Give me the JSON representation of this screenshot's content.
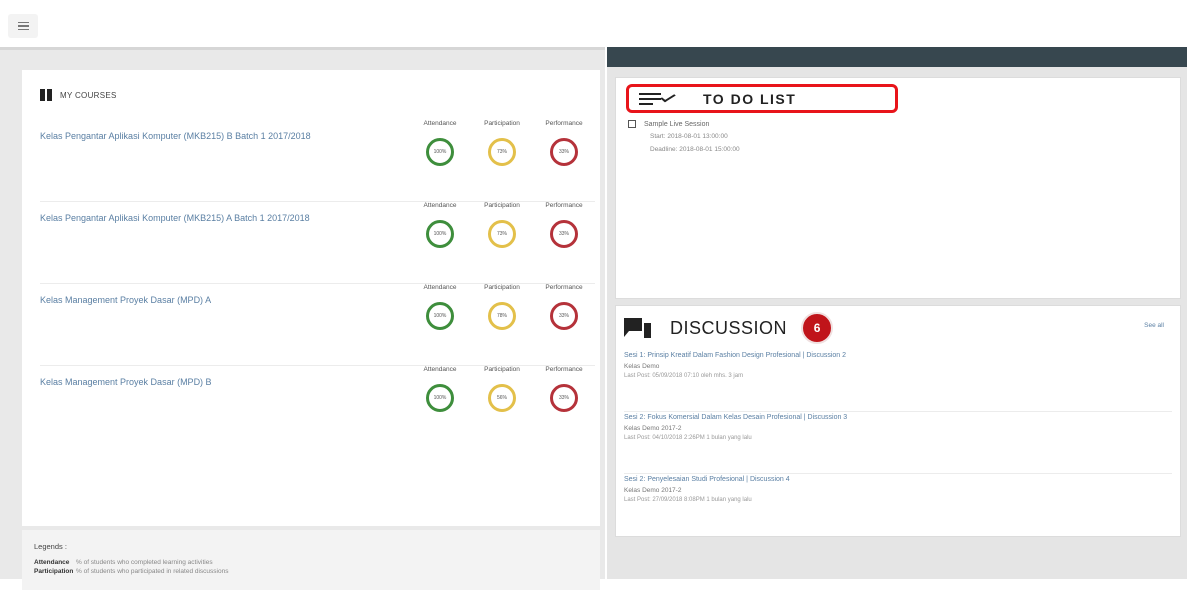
{
  "topbar": {
    "menu_icon": "hamburger-icon"
  },
  "courses": {
    "title": "MY COURSES",
    "metric_labels": [
      "Attendance",
      "Participation",
      "Performance"
    ],
    "items": [
      {
        "name": "Kelas Pengantar Aplikasi Komputer (MKB215) B Batch 1 2017/2018",
        "attendance": "100%",
        "participation": "73%",
        "performance": "33%"
      },
      {
        "name": "Kelas Pengantar Aplikasi Komputer (MKB215) A Batch 1 2017/2018",
        "attendance": "100%",
        "participation": "73%",
        "performance": "33%"
      },
      {
        "name": "Kelas Management Proyek Dasar (MPD) A",
        "attendance": "100%",
        "participation": "78%",
        "performance": "33%"
      },
      {
        "name": "Kelas Management Proyek Dasar (MPD) B",
        "attendance": "100%",
        "participation": "56%",
        "performance": "33%"
      }
    ],
    "colors": {
      "attendance": "#3e8e3c",
      "participation": "#e3c04a",
      "performance": "#b5323a"
    }
  },
  "legend": {
    "title": "Legends :",
    "rows": [
      {
        "key": "Attendance",
        "desc": "% of students who completed learning activities"
      },
      {
        "key": "Participation",
        "desc": "% of students who participated in related discussions"
      }
    ]
  },
  "todo": {
    "title": "TO DO LIST",
    "item_label": "Sample Live Session",
    "start": "Start: 2018-08-01 13:00:00",
    "deadline": "Deadline: 2018-08-01 15:00:00"
  },
  "discussion": {
    "title": "DISCUSSION",
    "badge": "6",
    "see_all": "See all",
    "items": [
      {
        "title": "Sesi 1: Prinsip Kreatif Dalam Fashion Design Profesional | Discussion 2",
        "sub": "Kelas Demo",
        "last": "Last Post: 05/09/2018 07:10 oleh mhs. 3 jam"
      },
      {
        "title": "Sesi 2: Fokus Komersial Dalam Kelas Desain Profesional | Discussion 3",
        "sub": "Kelas Demo 2017-2",
        "last": "Last Post: 04/10/2018 2:26PM 1 bulan yang lalu"
      },
      {
        "title": "Sesi 2: Penyelesaian Studi Profesional | Discussion 4",
        "sub": "Kelas Demo 2017-2",
        "last": "Last Post: 27/09/2018 8:08PM 1 bulan yang lalu"
      }
    ]
  }
}
